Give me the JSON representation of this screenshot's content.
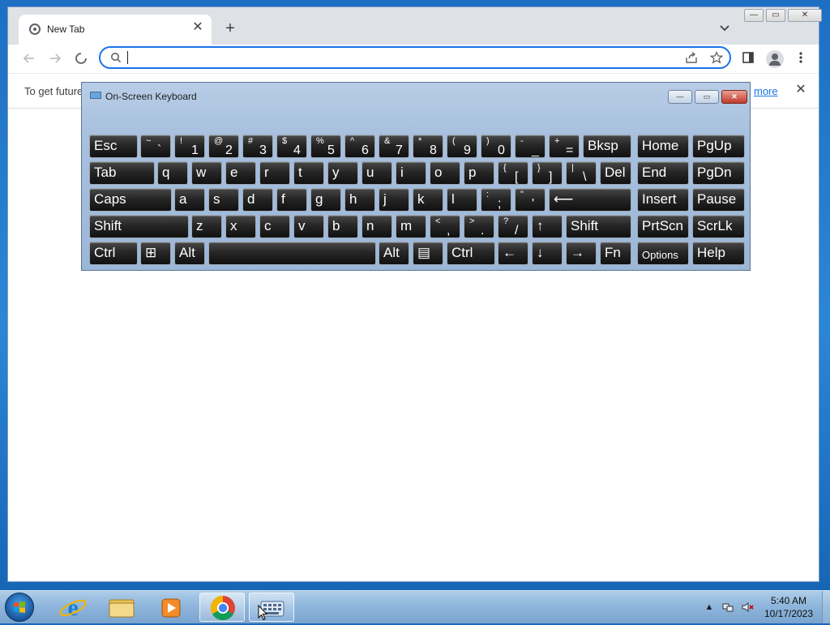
{
  "browser": {
    "tab_title": "New Tab",
    "tab_close": "✕",
    "new_tab": "+",
    "omnibox_value": "",
    "infobar_text": "To get future",
    "infobar_link": "more",
    "infobar_close": "✕"
  },
  "window_buttons": {
    "minimize": "—",
    "maximize": "▭",
    "close": "✕"
  },
  "osk": {
    "title": "On-Screen Keyboard",
    "buttons": {
      "minimize": "—",
      "restore": "▭",
      "close": "✕"
    },
    "rows": [
      [
        {
          "main": "Esc"
        },
        {
          "shift": "~",
          "low": "`"
        },
        {
          "shift": "!",
          "low": "1"
        },
        {
          "shift": "@",
          "low": "2"
        },
        {
          "shift": "#",
          "low": "3"
        },
        {
          "shift": "$",
          "low": "4"
        },
        {
          "shift": "%",
          "low": "5"
        },
        {
          "shift": "^",
          "low": "6"
        },
        {
          "shift": "&",
          "low": "7"
        },
        {
          "shift": "*",
          "low": "8"
        },
        {
          "shift": "(",
          "low": "9"
        },
        {
          "shift": ")",
          "low": "0"
        },
        {
          "shift": "-",
          "low": "_"
        },
        {
          "shift": "+",
          "low": "="
        },
        {
          "main": "Bksp"
        },
        {
          "main": "Home"
        },
        {
          "main": "PgUp"
        }
      ],
      [
        {
          "main": "Tab"
        },
        {
          "main": "q"
        },
        {
          "main": "w"
        },
        {
          "main": "e"
        },
        {
          "main": "r"
        },
        {
          "main": "t"
        },
        {
          "main": "y"
        },
        {
          "main": "u"
        },
        {
          "main": "i"
        },
        {
          "main": "o"
        },
        {
          "main": "p"
        },
        {
          "shift": "{",
          "low": "["
        },
        {
          "shift": "}",
          "low": "]"
        },
        {
          "shift": "|",
          "low": "\\"
        },
        {
          "main": "Del"
        },
        {
          "main": "End"
        },
        {
          "main": "PgDn"
        }
      ],
      [
        {
          "main": "Caps"
        },
        {
          "main": "a"
        },
        {
          "main": "s"
        },
        {
          "main": "d"
        },
        {
          "main": "f"
        },
        {
          "main": "g"
        },
        {
          "main": "h"
        },
        {
          "main": "j"
        },
        {
          "main": "k"
        },
        {
          "main": "l"
        },
        {
          "shift": ":",
          "low": ";"
        },
        {
          "shift": "\"",
          "low": "'"
        },
        {
          "main": "⟵"
        },
        {
          "main": "Insert"
        },
        {
          "main": "Pause"
        }
      ],
      [
        {
          "main": "Shift"
        },
        {
          "main": "z"
        },
        {
          "main": "x"
        },
        {
          "main": "c"
        },
        {
          "main": "v"
        },
        {
          "main": "b"
        },
        {
          "main": "n"
        },
        {
          "main": "m"
        },
        {
          "shift": "<",
          "low": ","
        },
        {
          "shift": ">",
          "low": "."
        },
        {
          "shift": "?",
          "low": "/"
        },
        {
          "main": "↑"
        },
        {
          "main": "Shift"
        },
        {
          "main": "PrtScn"
        },
        {
          "main": "ScrLk"
        }
      ],
      [
        {
          "main": "Ctrl"
        },
        {
          "main": "⊞"
        },
        {
          "main": "Alt"
        },
        {
          "main": ""
        },
        {
          "main": "Alt"
        },
        {
          "main": "▤"
        },
        {
          "main": "Ctrl"
        },
        {
          "main": "←"
        },
        {
          "main": "↓"
        },
        {
          "main": "→"
        },
        {
          "main": "Fn"
        },
        {
          "main": "Options"
        },
        {
          "main": "Help"
        }
      ]
    ]
  },
  "taskbar": {
    "time": "5:40 AM",
    "date": "10/17/2023",
    "tray_arrow": "▲"
  },
  "icons": {
    "back": "back-arrow-icon",
    "forward": "forward-arrow-icon",
    "reload": "stop-loading-icon",
    "search": "search-icon",
    "share": "share-icon",
    "bookmark": "star-icon",
    "side_panel": "side-panel-icon",
    "profile": "profile-icon",
    "menu": "kebab-menu-icon"
  }
}
